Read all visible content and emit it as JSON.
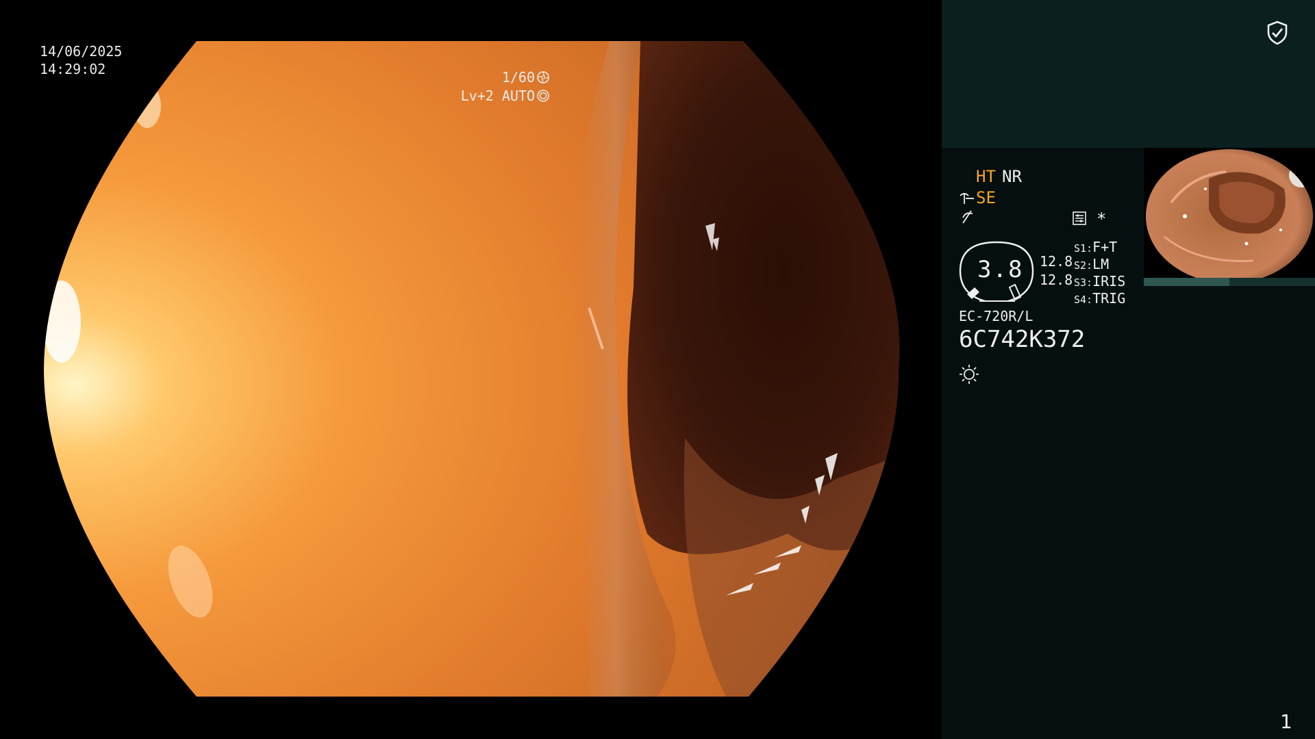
{
  "overlay": {
    "date": "14/06/2025",
    "time": "14:29:02",
    "shutter": "1/60",
    "level": "Lv+2 AUTO"
  },
  "panel": {
    "mode_ht": "HT",
    "mode_nr": "NR",
    "mode_se": "SE",
    "asterisk": "*",
    "dial_value": "3.8",
    "value_a": "12.8",
    "value_b": "12.8",
    "switches": [
      {
        "key": "S1:",
        "value": "F+T"
      },
      {
        "key": "S2:",
        "value": "LM"
      },
      {
        "key": "S3:",
        "value": "IRIS"
      },
      {
        "key": "S4:",
        "value": "TRIG"
      }
    ],
    "scope_model": "EC-720R/L",
    "scope_serial": "6C742K372",
    "page_number": "1"
  },
  "icons": {
    "shield": "shield-check-icon",
    "enhancement": "structure-enhancement-icon",
    "freeze": "freeze-icon",
    "settings": "settings-list-icon",
    "dial": "air-pressure-dial-icon",
    "brightness": "brightness-icon",
    "shutter": "shutter-icon",
    "auto_iris": "auto-iris-icon"
  },
  "colors": {
    "accent": "#f5a623",
    "panel_bg": "#060f0f",
    "panel_top_bg": "#0b1f1f",
    "text": "#f0f0f0"
  }
}
